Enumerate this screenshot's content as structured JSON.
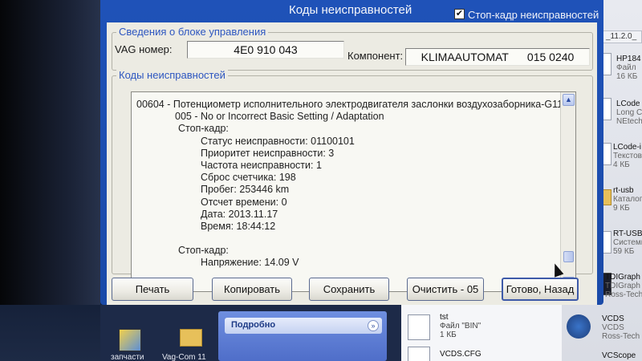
{
  "dialog": {
    "title": "Коды неисправностей",
    "stopframe_checked": true,
    "stopframe_check_glyph": "✔",
    "stopframe_label": "Стоп-кадр неисправностей"
  },
  "control_unit": {
    "legend": "Сведения о блоке управления",
    "vag_label": "VAG номер:",
    "vag_value": "4E0 910 043",
    "component_label": "Компонент:",
    "component_value": "KLIMAAUTOMAT      015 0240"
  },
  "codes": {
    "legend": "Коды неисправностей",
    "lines": [
      "00604 - Потенциометр исполнительного электродвигателя заслонки воздухозаборника-G11",
      "005 - No or Incorrect Basic Setting / Adaptation",
      "Стоп-кадр:",
      "Статус неисправности: 01100101",
      "Приоритет неисправности: 3",
      "Частота неисправности: 1",
      "Сброс счетчика: 198",
      "Пробег: 253446 km",
      "Отсчет времени: 0",
      "Дата: 2013.11.17",
      "Время: 18:44:12",
      "",
      "Стоп-кадр:",
      "Напряжение: 14.09 V"
    ]
  },
  "scroll": {
    "up_glyph": "▲",
    "down_glyph": "▼"
  },
  "buttons": {
    "print": "Печать",
    "copy": "Копировать",
    "save": "Сохранить",
    "clear": "Очистить - 05",
    "done": "Готово, Назад"
  },
  "explorer": {
    "path": "_11.2.0_",
    "items": [
      {
        "name": "HP184",
        "type": "Файл",
        "size": "16 КБ"
      },
      {
        "name": "LCode",
        "type": "Long Co",
        "size": "NEtech"
      },
      {
        "name": "LCode-i",
        "type": "Текстов",
        "size": "4 КБ"
      },
      {
        "name": "rt-usb",
        "type": "Каталог",
        "size": "9 КБ"
      },
      {
        "name": "RT-USB",
        "type": "Системн",
        "size": "59 КБ"
      },
      {
        "name": "TDIGraph",
        "type": "TDIGraph",
        "size": "Ross-Tech"
      },
      {
        "name": "VCDS",
        "type": "VCDS",
        "size": "Ross-Tech"
      },
      {
        "name": "VCScope",
        "type": "",
        "size": ""
      }
    ]
  },
  "details": {
    "label": "Подробно",
    "chevron": "»"
  },
  "files": [
    {
      "name": "tst",
      "type": "Файл \"BIN\"",
      "size": "1 КБ"
    },
    {
      "name": "VCDS.CFG",
      "type": "",
      "size": ""
    }
  ],
  "desktop": {
    "icon1_label": "запчасти",
    "icon2_label": "Vag-Com 11"
  },
  "colors": {
    "dialog_blue": "#1f52b8",
    "legend_blue": "#2d56c0",
    "client_bg": "#ecebe3"
  }
}
